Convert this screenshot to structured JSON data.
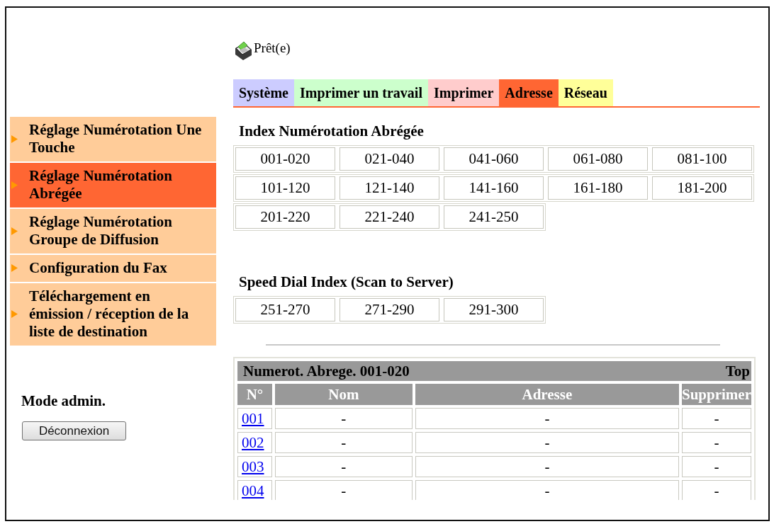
{
  "status": {
    "text": "Prêt(e)"
  },
  "tabs": [
    {
      "label": "Système",
      "selected": false,
      "color": "#ccccff"
    },
    {
      "label": "Imprimer un travail",
      "selected": false,
      "color": "#ccffcc"
    },
    {
      "label": "Imprimer",
      "selected": false,
      "color": "#ffcccc"
    },
    {
      "label": "Adresse",
      "selected": true
    },
    {
      "label": "Réseau",
      "selected": false,
      "color": "#ffff99"
    }
  ],
  "sidebar": {
    "items": [
      {
        "label": "Réglage Numérotation Une Touche",
        "selected": false
      },
      {
        "label": "Réglage Numérotation Abrégée",
        "selected": true
      },
      {
        "label": "Réglage Numérotation Groupe de Diffusion",
        "selected": false
      },
      {
        "label": "Configuration du Fax",
        "selected": false
      },
      {
        "label": "Téléchargement en émission / réception de la liste de destination",
        "selected": false
      }
    ],
    "admin_label": "Mode admin.",
    "logout_button": "Déconnexion"
  },
  "index_sections": [
    {
      "title": "Index Numérotation Abrégée",
      "ranges": [
        "001-020",
        "021-040",
        "041-060",
        "061-080",
        "081-100",
        "101-120",
        "121-140",
        "141-160",
        "161-180",
        "181-200",
        "201-220",
        "221-240",
        "241-250"
      ]
    },
    {
      "title": "Speed Dial Index (Scan to Server)",
      "ranges": [
        "251-270",
        "271-290",
        "291-300"
      ]
    }
  ],
  "table": {
    "title": "Numerot. Abrege. 001-020",
    "top_link": "Top",
    "columns": [
      "N°",
      "Nom",
      "Adresse",
      "Supprimer"
    ],
    "rows": [
      {
        "number": "001",
        "name": "-",
        "address": "-",
        "delete": "-"
      },
      {
        "number": "002",
        "name": "-",
        "address": "-",
        "delete": "-"
      },
      {
        "number": "003",
        "name": "-",
        "address": "-",
        "delete": "-"
      },
      {
        "number": "004",
        "name": "-",
        "address": "-",
        "delete": "-"
      }
    ]
  }
}
